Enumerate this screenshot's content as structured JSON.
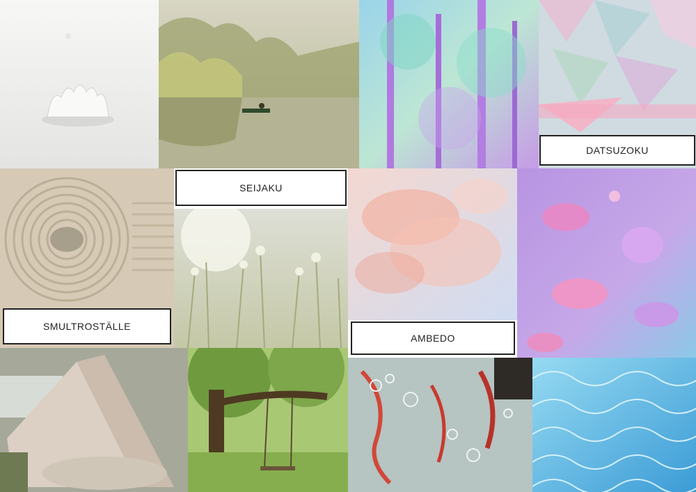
{
  "board": {
    "labels": {
      "datsuzoku": "DATSUZOKU",
      "seijaku": "SEIJAKU",
      "smultrostalle": "SMULTROSTÄLLE",
      "ambedo": "AMBEDO"
    },
    "images": [
      {
        "name": "milk-splash-photo",
        "colors": [
          "#f4f4f2",
          "#e6e6e4"
        ]
      },
      {
        "name": "misty-lake-boat-photo",
        "colors": [
          "#c8c39a",
          "#8c8a62"
        ]
      },
      {
        "name": "pastel-forest-photo",
        "colors": [
          "#a4d8e6",
          "#b77ee0"
        ]
      },
      {
        "name": "iridescent-shards-photo",
        "colors": [
          "#c9d7dc",
          "#f1b0c8"
        ]
      },
      {
        "name": "zen-sand-garden-photo",
        "colors": [
          "#d8ccb9",
          "#b8aa92"
        ]
      },
      {
        "name": "meadow-grass-photo",
        "colors": [
          "#eef0e4",
          "#c9cfae"
        ]
      },
      {
        "name": "pink-ink-cloud-photo",
        "colors": [
          "#f6c6bc",
          "#c8d8ee"
        ]
      },
      {
        "name": "pastel-fish-photo",
        "colors": [
          "#c6a0e6",
          "#7ec6e4"
        ]
      },
      {
        "name": "canopy-tent-photo",
        "colors": [
          "#d6c8bc",
          "#8c8a7a"
        ]
      },
      {
        "name": "tree-swing-photo",
        "colors": [
          "#9ec468",
          "#4f7a2e"
        ]
      },
      {
        "name": "red-bubbles-water-photo",
        "colors": [
          "#b6c6c4",
          "#c84a3a"
        ]
      },
      {
        "name": "pool-water-photo",
        "colors": [
          "#8fd6f0",
          "#3f9ed8"
        ]
      }
    ]
  }
}
